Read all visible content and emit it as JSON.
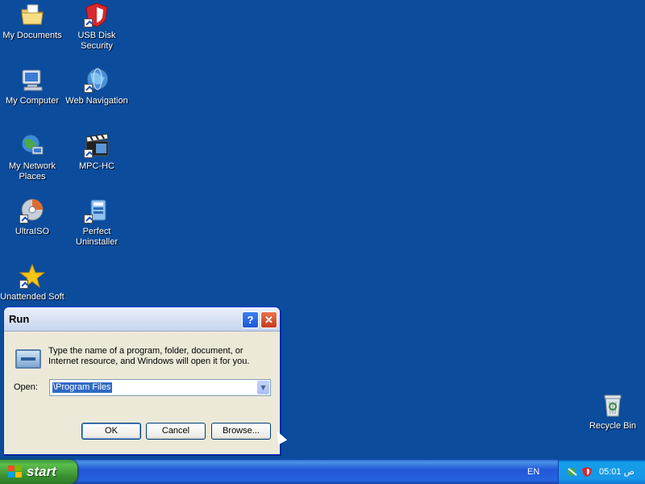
{
  "desktop": {
    "icons": [
      {
        "label": "My Documents",
        "icon": "folder-documents-icon"
      },
      {
        "label": "USB Disk Security",
        "icon": "usb-shield-icon"
      },
      {
        "label": "My Computer",
        "icon": "computer-icon"
      },
      {
        "label": "Web Navigation",
        "icon": "globe-icon"
      },
      {
        "label": "My Network Places",
        "icon": "network-icon"
      },
      {
        "label": "MPC-HC",
        "icon": "clapperboard-icon"
      },
      {
        "label": "UltraISO",
        "icon": "disc-icon"
      },
      {
        "label": "Perfect Uninstaller",
        "icon": "uninstaller-icon"
      },
      {
        "label": "Unattended Soft",
        "icon": "star-icon"
      },
      {
        "label": "Recycle Bin",
        "icon": "recycle-bin-icon"
      }
    ]
  },
  "run_dialog": {
    "title": "Run",
    "help_glyph": "?",
    "close_glyph": "✕",
    "description": "Type the name of a program, folder, document, or Internet resource, and Windows will open it for you.",
    "open_label": "Open:",
    "open_value": "\\Program Files",
    "buttons": {
      "ok": "OK",
      "cancel": "Cancel",
      "browse": "Browse..."
    }
  },
  "taskbar": {
    "start_label": "start",
    "language": "EN",
    "clock": "05:01 ص"
  },
  "colors": {
    "desktop": "#0b4c9d",
    "taskbar": "#2157d7",
    "start": "#3c9a3c",
    "selection": "#316ac5"
  }
}
